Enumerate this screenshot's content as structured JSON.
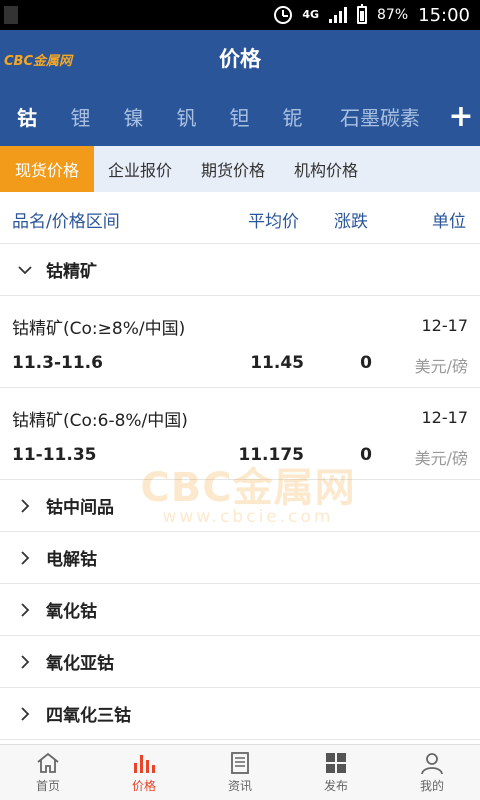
{
  "status_bar": {
    "network": "4G",
    "battery": "87%",
    "time": "15:00"
  },
  "header": {
    "logo": "CBC金属网",
    "title": "价格"
  },
  "categories": [
    {
      "label": "钴",
      "active": true
    },
    {
      "label": "锂"
    },
    {
      "label": "镍"
    },
    {
      "label": "钒"
    },
    {
      "label": "钽"
    },
    {
      "label": "铌"
    },
    {
      "label": "石墨碳素"
    }
  ],
  "category_add": "+",
  "sub_tabs": [
    {
      "label": "现货价格",
      "active": true
    },
    {
      "label": "企业报价"
    },
    {
      "label": "期货价格"
    },
    {
      "label": "机构价格"
    }
  ],
  "columns": {
    "name": "品名/价格区间",
    "avg": "平均价",
    "change": "涨跌",
    "unit": "单位"
  },
  "expanded_group": "钴精矿",
  "items": [
    {
      "name": "钴精矿(Co:≥8%/中国)",
      "date": "12-17",
      "range": "11.3-11.6",
      "avg": "11.45",
      "change": "0",
      "unit": "美元/磅"
    },
    {
      "name": "钴精矿(Co:6-8%/中国)",
      "date": "12-17",
      "range": "11-11.35",
      "avg": "11.175",
      "change": "0",
      "unit": "美元/磅"
    }
  ],
  "collapsed_groups": [
    "钴中间品",
    "电解钴",
    "氧化钴",
    "氧化亚钴",
    "四氧化三钴"
  ],
  "watermark": {
    "main": "CBC金属网",
    "sub": "www.cbcie.com"
  },
  "nav": [
    {
      "label": "首页",
      "icon": "home-icon"
    },
    {
      "label": "价格",
      "icon": "bar-chart-icon",
      "active": true
    },
    {
      "label": "资讯",
      "icon": "document-icon"
    },
    {
      "label": "发布",
      "icon": "grid-icon"
    },
    {
      "label": "我的",
      "icon": "user-icon"
    }
  ],
  "colors": {
    "primary": "#2a5699",
    "accent": "#f29b1a",
    "active_nav": "#e8442a"
  }
}
